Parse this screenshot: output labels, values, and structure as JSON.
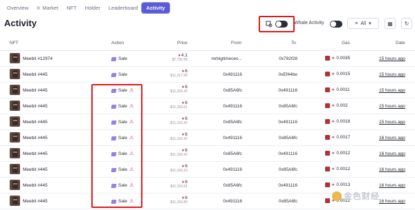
{
  "tabs": [
    {
      "label": "Overview",
      "active": false
    },
    {
      "label": "Market",
      "active": false
    },
    {
      "label": "NFT",
      "active": false
    },
    {
      "label": "Holder",
      "active": false
    },
    {
      "label": "Leaderboard",
      "active": false
    },
    {
      "label": "Activity",
      "active": true
    }
  ],
  "header": {
    "title": "Activity",
    "whale_label": "Whale Activity",
    "select_value": "All",
    "select_icon": "chevron-down-icon",
    "calendar_icon": "calendar-icon",
    "refresh_icon": "refresh-icon"
  },
  "table": {
    "columns": {
      "nft": "NFT",
      "action": "Action",
      "price": "Price",
      "from": "From",
      "to": "To",
      "gas": "Gas",
      "date": "Date"
    },
    "rows": [
      {
        "nft": "Meebit #12974",
        "action": "Sale",
        "warn": false,
        "eth": "4.1",
        "usd": "$7,735.99",
        "from": "mrbigtimeceo...",
        "to": "0x792f28",
        "gas": "0.0035",
        "date": "15 hours ago"
      },
      {
        "nft": "Meebit #445",
        "action": "Sale",
        "warn": false,
        "eth": "6",
        "usd": "$11,317.55",
        "from": "0x491116",
        "to": "0xEf44be",
        "gas": "0.0015",
        "date": "15 hours ago"
      },
      {
        "nft": "Meebit #445",
        "action": "Sale",
        "warn": true,
        "eth": "6",
        "usd": "$11,316.42",
        "from": "0x85A6fc",
        "to": "0x491116",
        "gas": "0.0011",
        "date": "15 hours ago"
      },
      {
        "nft": "Meebit #445",
        "action": "Sale",
        "warn": true,
        "eth": "6",
        "usd": "$11,316.61",
        "from": "0x491116",
        "to": "0x85A6fc",
        "gas": "0.002",
        "date": "15 hours ago"
      },
      {
        "nft": "Meebit #445",
        "action": "Sale",
        "warn": true,
        "eth": "6",
        "usd": "$11,316.42",
        "from": "0x85A6fc",
        "to": "0x491116",
        "gas": "0.0018",
        "date": "15 hours ago"
      },
      {
        "nft": "Meebit #445",
        "action": "Sale",
        "warn": true,
        "eth": "6",
        "usd": "$11,316.42",
        "from": "0x491116",
        "to": "0x85A6fc",
        "gas": "0.0017",
        "date": "16 hours ago"
      },
      {
        "nft": "Meebit #445",
        "action": "Sale",
        "warn": true,
        "eth": "6",
        "usd": "$11,316.42",
        "from": "0x85A6fc",
        "to": "0x491116",
        "gas": "0.0012",
        "date": "16 hours ago"
      },
      {
        "nft": "Meebit #445",
        "action": "Sale",
        "warn": true,
        "eth": "6",
        "usd": "$11,316.23",
        "from": "0x491116",
        "to": "0x85A6fc",
        "gas": "0.0012",
        "date": "16 hours ago"
      },
      {
        "nft": "Meebit #445",
        "action": "Sale",
        "warn": true,
        "eth": "6",
        "usd": "$11,316.61",
        "from": "0x85A6fc",
        "to": "0x491116",
        "gas": "0.0013",
        "date": "16 hours ago"
      },
      {
        "nft": "Meebit #445",
        "action": "Sale",
        "warn": true,
        "eth": "6",
        "usd": "$11,316.80",
        "from": "0x491116",
        "to": "0x85A6fc",
        "gas": "0.0012",
        "date": "16 hours ago"
      }
    ]
  },
  "watermark": "金色财经",
  "colors": {
    "accent": "#5b5bd6",
    "highlight": "#e2171b",
    "eth": "#d23a5b"
  }
}
